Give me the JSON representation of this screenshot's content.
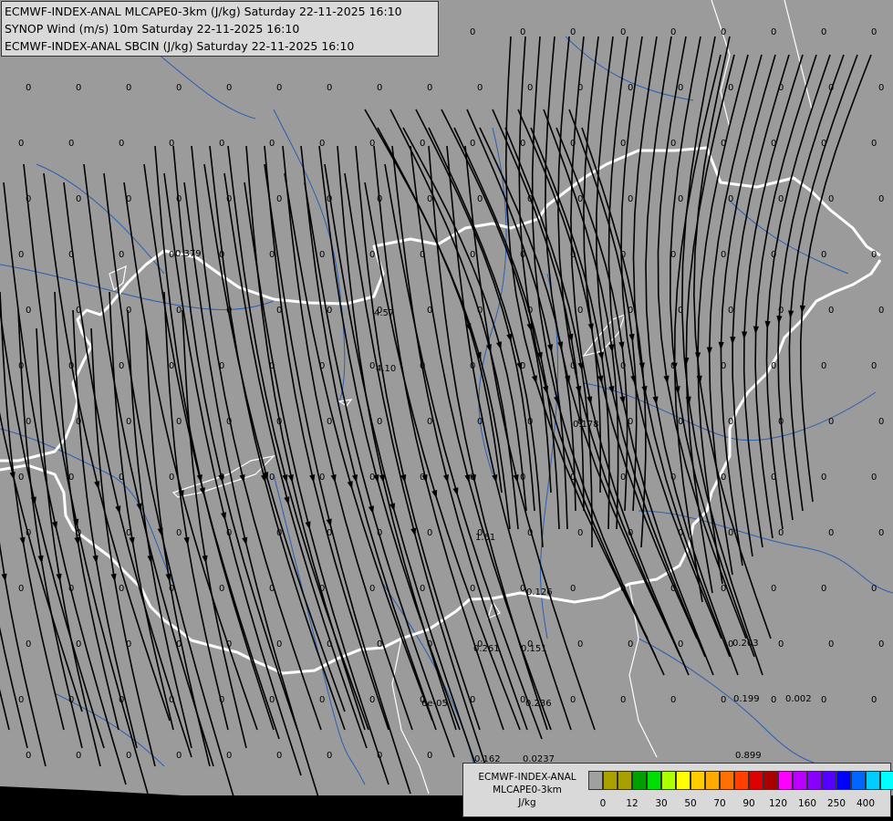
{
  "header": {
    "lines": [
      "ECMWF-INDEX-ANAL MLCAPE0-3km (J/kg) Saturday 22-11-2025 16:10",
      "SYNOP Wind (m/s) 10m Saturday 22-11-2025 16:10",
      "ECMWF-INDEX-ANAL SBCIN (J/kg) Saturday 22-11-2025 16:10"
    ]
  },
  "legend": {
    "title_lines": [
      "ECMWF-INDEX-ANAL",
      "MLCAPE0-3km",
      "J/kg"
    ],
    "colors": [
      "#a0a0a0",
      "#aaa000",
      "#a8a000",
      "#00a000",
      "#00e000",
      "#aaff00",
      "#ffff00",
      "#ffcc00",
      "#ffaa00",
      "#ff7000",
      "#ff4000",
      "#dd0000",
      "#aa0000",
      "#ff00ff",
      "#bb00ff",
      "#8800ff",
      "#5500ff",
      "#0000ff",
      "#0066ff",
      "#00ccff",
      "#00ffff",
      "#aaffff",
      "#ffffff"
    ],
    "ticks": [
      "0",
      "12",
      "30",
      "50",
      "70",
      "90",
      "120",
      "160",
      "250",
      "400"
    ]
  },
  "map": {
    "background_color": "#9b9b9b",
    "border_color": "#ffffff",
    "river_color": "#2a5fb0",
    "streamline_color": "#000000",
    "nonzero_labels": [
      "0.379",
      "4.57",
      "4.10",
      "0.178",
      "1.61",
      "0.126",
      "0.261",
      "0.151",
      "0.203",
      "0.236",
      "6e-05",
      "0.199",
      "0.002",
      "0.162",
      "0.0237",
      "0.899"
    ]
  }
}
